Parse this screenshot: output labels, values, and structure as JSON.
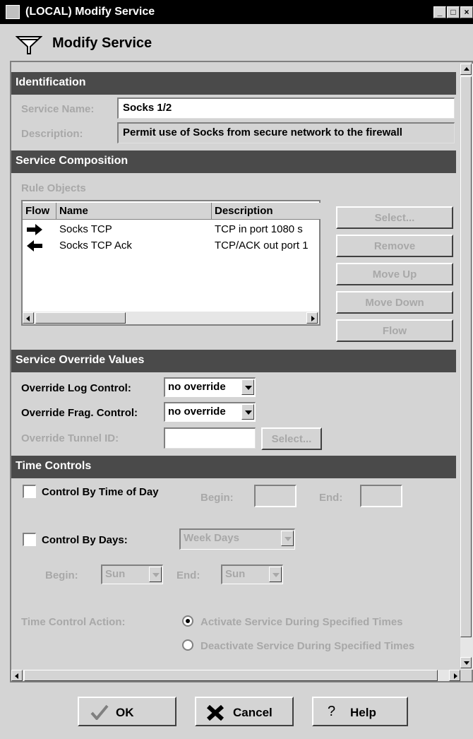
{
  "window": {
    "title": "(LOCAL) Modify Service",
    "min": "_",
    "max": "□",
    "close": "×"
  },
  "header": {
    "title": "Modify Service"
  },
  "identification": {
    "heading": "Identification",
    "name_label": "Service Name:",
    "name_value": "Socks 1/2",
    "desc_label": "Description:",
    "desc_value": "Permit use of Socks from secure network to the firewall"
  },
  "composition": {
    "heading": "Service Composition",
    "rule_objects_label": "Rule Objects",
    "columns": [
      "Flow",
      "Name",
      "Description"
    ],
    "rows": [
      {
        "flow": "right-arrow-icon",
        "name": "Socks TCP",
        "description": "TCP in port 1080 s"
      },
      {
        "flow": "left-arrow-icon",
        "name": "Socks TCP Ack",
        "description": "TCP/ACK out port 1"
      }
    ],
    "buttons": {
      "select": "Select...",
      "remove": "Remove",
      "move_up": "Move Up",
      "move_down": "Move Down",
      "flow": "Flow"
    }
  },
  "override": {
    "heading": "Service Override Values",
    "log_label": "Override Log Control:",
    "log_value": "no override",
    "frag_label": "Override Frag. Control:",
    "frag_value": "no override",
    "tunnel_label": "Override Tunnel ID:",
    "tunnel_value": "",
    "tunnel_select": "Select..."
  },
  "time": {
    "heading": "Time Controls",
    "tod_label": "Control By Time of Day",
    "begin_label": "Begin:",
    "end_label": "End:",
    "days_label": "Control By Days:",
    "days_value": "Week Days",
    "day_begin_label": "Begin:",
    "day_begin_value": "Sun",
    "day_end_label": "End:",
    "day_end_value": "Sun",
    "action_label": "Time Control Action:",
    "activate": "Activate Service During Specified Times",
    "deactivate": "Deactivate Service During Specified Times"
  },
  "footer": {
    "ok": "OK",
    "cancel": "Cancel",
    "help": "Help"
  }
}
